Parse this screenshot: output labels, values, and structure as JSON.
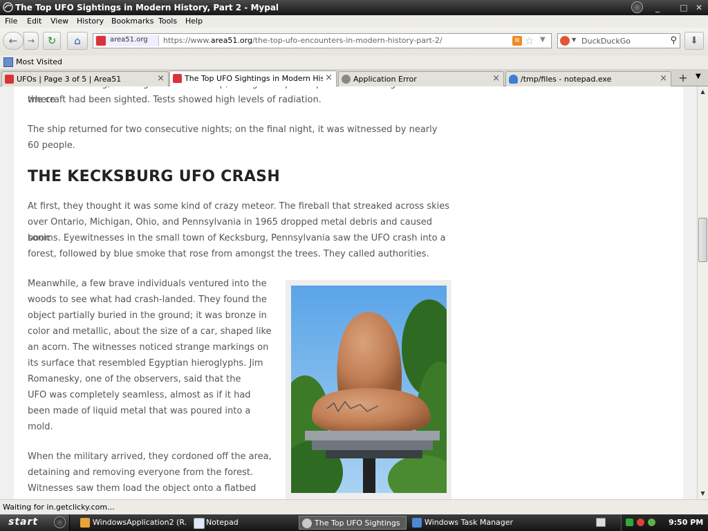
{
  "window": {
    "title": "The Top UFO Sightings in Modern History, Part 2 - Mypal",
    "controls": [
      "_",
      "□",
      "✕"
    ]
  },
  "menu": [
    "File",
    "Edit",
    "View",
    "History",
    "Bookmarks",
    "Tools",
    "Help"
  ],
  "nav": {
    "site_identity": "area51.org",
    "url_prefix": "https://www.",
    "url_domain": "area51.org",
    "url_path": "/the-top-ufo-encounters-in-modern-history-part-2/",
    "search_placeholder": "DuckDuckGo"
  },
  "bookmarks": {
    "most_visited": "Most Visited"
  },
  "tabs": [
    {
      "label": "UFOs | Page 3 of 5 | Area51",
      "active": false,
      "favicon_color": "#d9333a"
    },
    {
      "label": "The Top UFO Sightings in Modern Histor...",
      "active": true,
      "favicon_color": "#d9333a"
    },
    {
      "label": "Application Error",
      "active": false,
      "favicon_color": "#888888"
    },
    {
      "label": "/tmp/files - notepad.exe",
      "active": false,
      "favicon_color": "#3a7fd6"
    }
  ],
  "article": {
    "p_intro_clipped": "The next morning, investigators found deep, triangle-shaped impressions in the ground where",
    "p1": "the craft had been sighted. Tests showed high levels of radiation.",
    "p2_line1": "The ship returned for two consecutive nights; on the final night, it was witnessed by nearly",
    "p2_line2": "60 people.",
    "heading": "THE KECKSBURG UFO CRASH",
    "p3": [
      "At first, they thought it was some kind of crazy meteor. The fireball that streaked across skies",
      "over Ontario, Michigan, Ohio, and Pennsylvania in 1965 dropped metal debris and caused sonic",
      "booms. Eyewitnesses in the small town of Kecksburg, Pennsylvania saw the UFO crash into a",
      "forest, followed by blue smoke that rose from amongst the trees. They called authorities."
    ],
    "p4": [
      "Meanwhile, a few brave individuals ventured into the",
      "woods to see what had crash-landed. They found the",
      "object partially buried in the ground; it was bronze in",
      "color and metallic, about the size of a car, shaped like",
      "an acorn. The witnesses noticed strange markings on",
      "its surface that resembled Egyptian hieroglyphs. Jim",
      "Romanesky, one of the observers, said that the",
      "UFO was completely seamless, almost as if it had",
      "been made of liquid metal that was poured into a",
      "mold."
    ],
    "p5": [
      "When the military arrived, they cordoned off the area,",
      "detaining and removing everyone from the forest.",
      "Witnesses saw them load the object onto a flatbed"
    ]
  },
  "status": "Waiting for in.getclicky.com...",
  "taskbar": {
    "start": "start",
    "tasks": [
      {
        "label": "WindowsApplication2 (R...",
        "icon_color": "#e8a33a",
        "active": false
      },
      {
        "label": "Notepad",
        "icon_color": "#dfe8f5",
        "active": false
      },
      {
        "label": "The Top UFO Sightings i...",
        "icon_color": "#c9c9c9",
        "active": true
      },
      {
        "label": "Windows Task Manager",
        "icon_color": "#4b8bd6",
        "active": false
      }
    ],
    "clock": "9:50 PM"
  }
}
